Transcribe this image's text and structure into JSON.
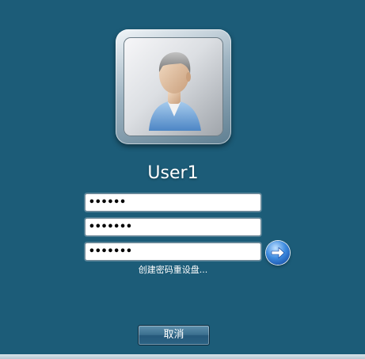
{
  "user": {
    "name": "User1",
    "avatar_icon": "user-avatar-icon"
  },
  "login": {
    "password_fields": [
      {
        "value": "••••••"
      },
      {
        "value": "•••••••"
      },
      {
        "value": "•••••••"
      }
    ],
    "submit_icon": "arrow-right-icon",
    "reset_link": "创建密码重设盘..."
  },
  "actions": {
    "cancel_label": "取消"
  },
  "colors": {
    "background": "#1c5c78",
    "button": "#3a6f8e",
    "submit": "#2f7ed8",
    "text": "#ffffff"
  }
}
